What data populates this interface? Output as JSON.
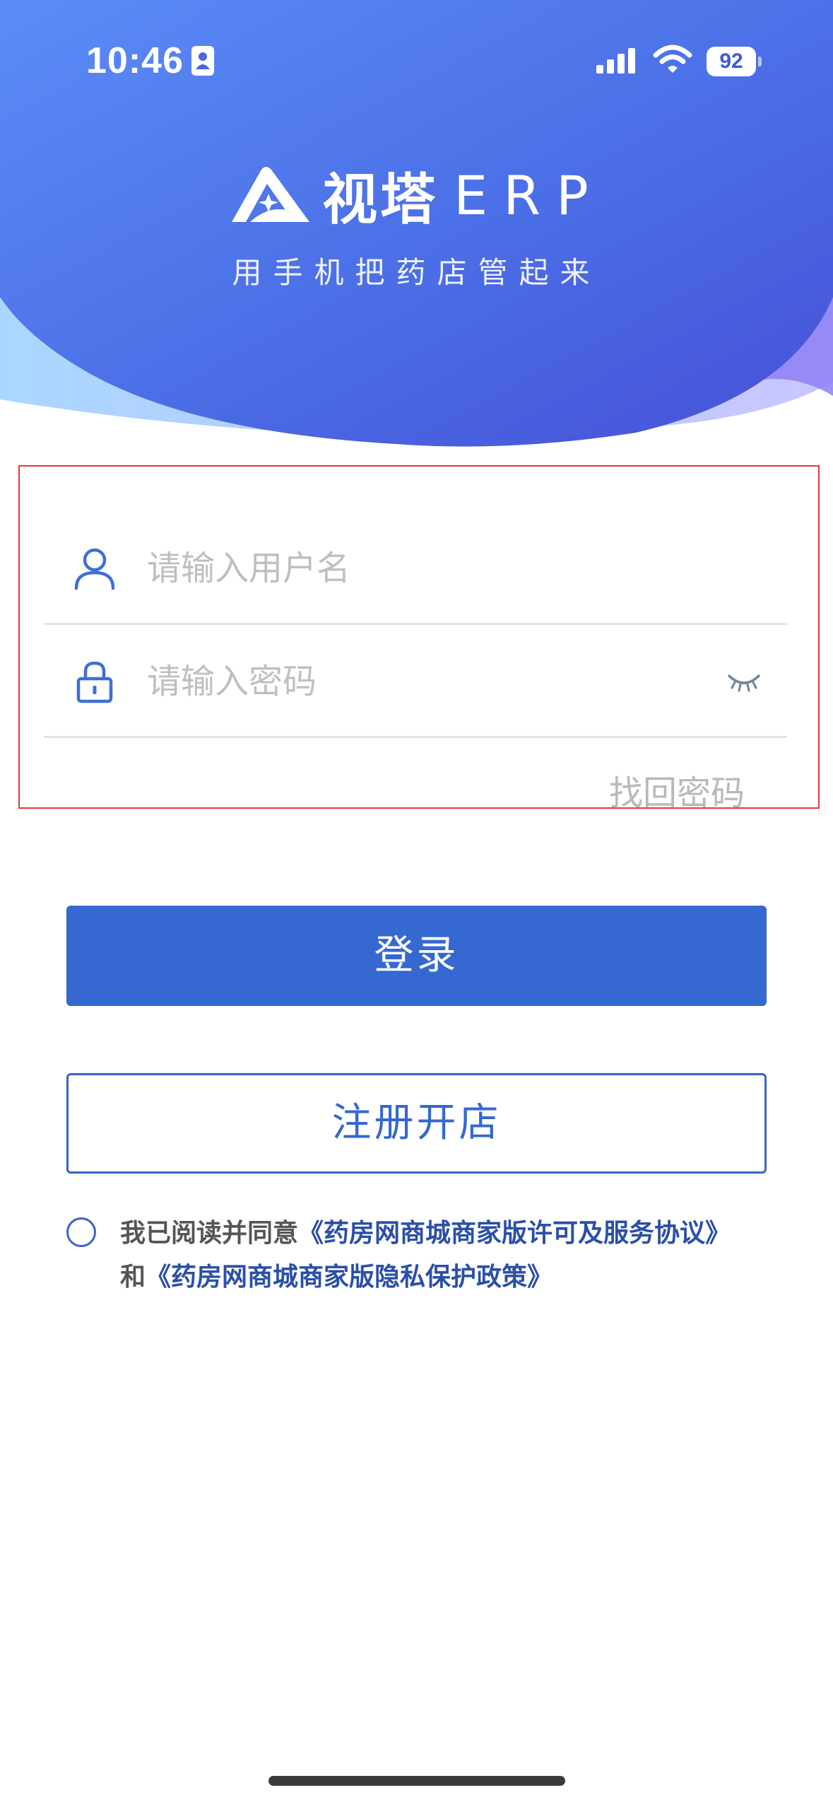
{
  "status_bar": {
    "time": "10:46",
    "battery": "92",
    "icons": [
      "id-card-icon",
      "signal-icon",
      "wifi-icon",
      "battery-icon"
    ]
  },
  "header": {
    "brand_name": "视塔",
    "brand_suffix": "ERP",
    "slogan": "用手机把药店管起来",
    "logo_icon": "mountain-logo-icon",
    "colors": {
      "gradient_start": "#5b8cf7",
      "gradient_end": "#4650d6"
    }
  },
  "form": {
    "username_placeholder": "请输入用户名",
    "password_placeholder": "请输入密码",
    "forgot_password": "找回密码",
    "username_icon": "user-icon",
    "password_icon": "lock-icon",
    "toggle_icon": "eye-closed-icon"
  },
  "actions": {
    "login_label": "登录",
    "register_label": "注册开店",
    "colors": {
      "primary": "#3569d1"
    }
  },
  "agreement": {
    "prefix": "我已阅读并同意",
    "service_link": "《药房网商城商家版许可及服务协议》",
    "connector": "和",
    "privacy_link": "《药房网商城商家版隐私保护政策》"
  }
}
